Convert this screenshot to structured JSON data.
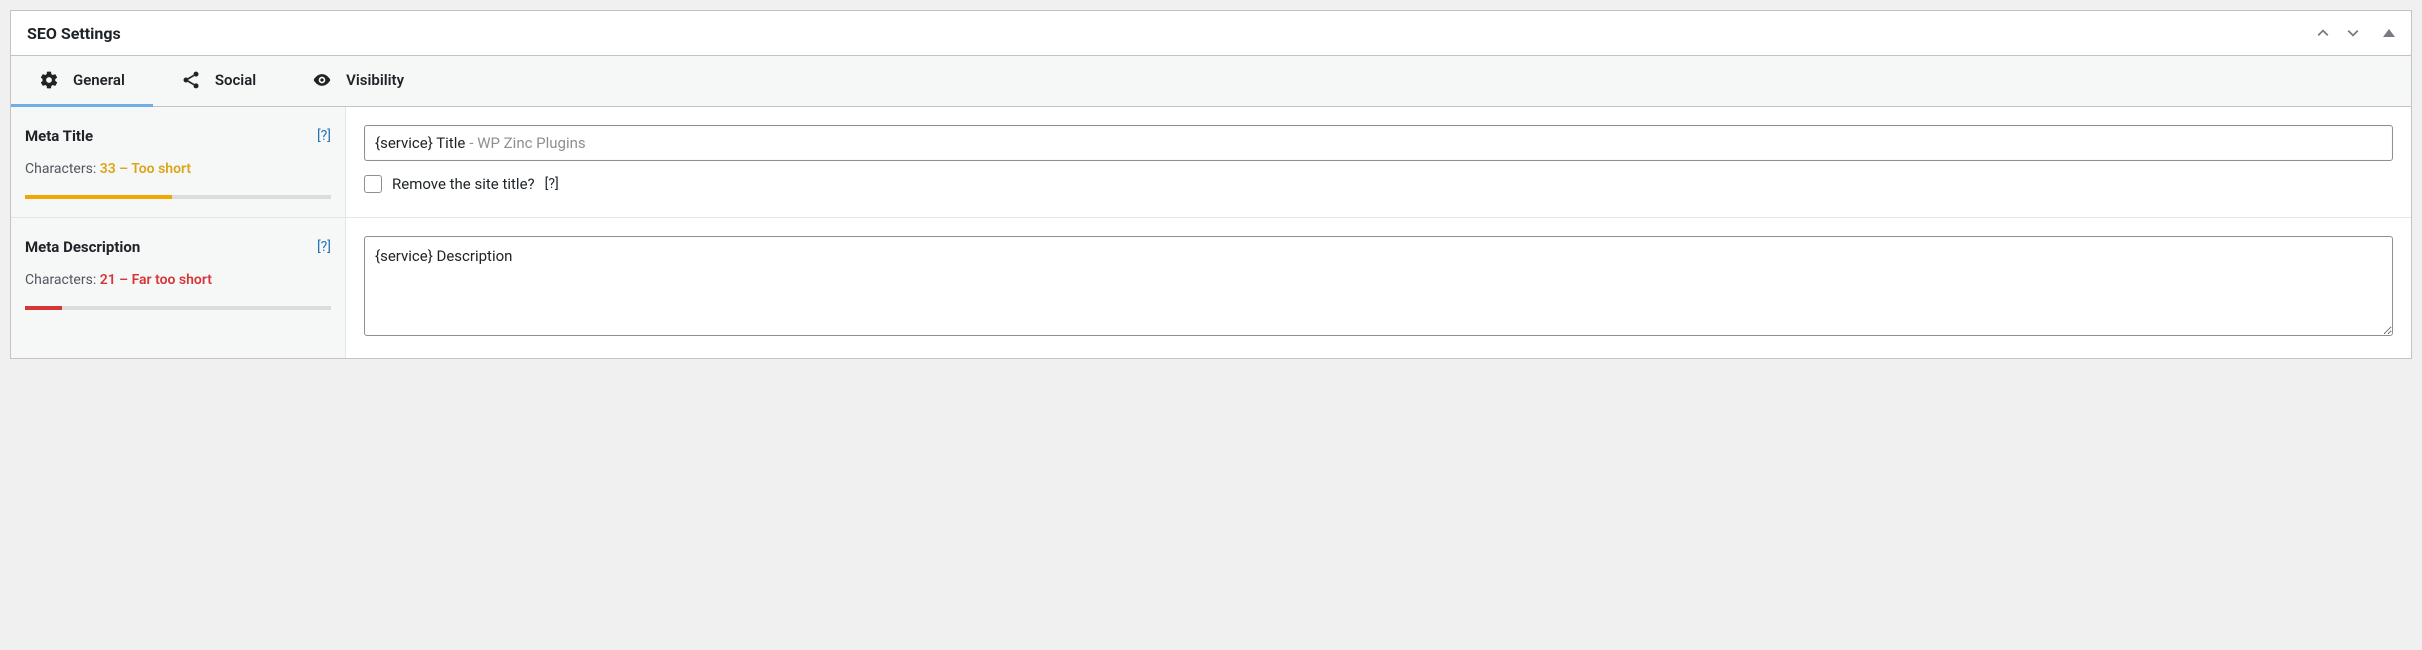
{
  "panel": {
    "title": "SEO Settings"
  },
  "tabs": [
    {
      "label": "General",
      "active": true
    },
    {
      "label": "Social",
      "active": false
    },
    {
      "label": "Visibility",
      "active": false
    }
  ],
  "meta_title": {
    "label": "Meta Title",
    "help": "[?]",
    "chars_prefix": "Characters: ",
    "chars_value": "33 – Too short",
    "chars_status": "warning",
    "value": "{service} Title",
    "suffix": " - WP Zinc Plugins",
    "checkbox_label": "Remove the site title?",
    "checkbox_help": "[?]"
  },
  "meta_description": {
    "label": "Meta Description",
    "help": "[?]",
    "chars_prefix": "Characters: ",
    "chars_value": "21 – Far too short",
    "chars_status": "error",
    "value": "{service} Description"
  }
}
